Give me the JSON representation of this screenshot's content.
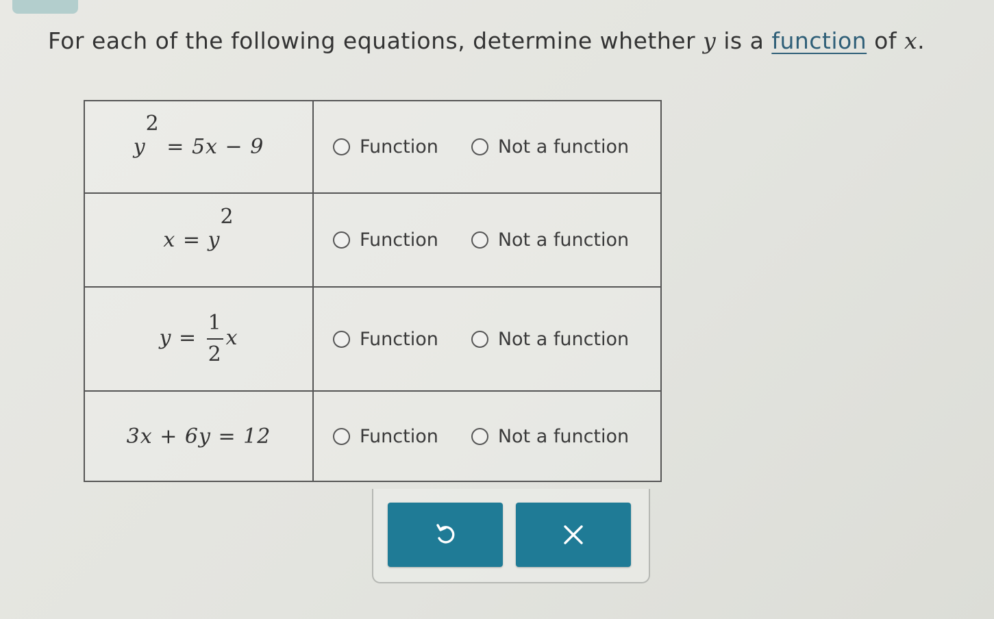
{
  "question": {
    "prefix": "For each of the following equations, determine whether ",
    "var_y": "y",
    "middle": " is a ",
    "link": "function",
    "of_text": " of ",
    "var_x": "x",
    "suffix": "."
  },
  "rows": [
    {
      "equation": {
        "base": "y",
        "exponent": "2",
        "rest": " = 5x − 9"
      },
      "options": [
        "Function",
        "Not a function"
      ]
    },
    {
      "equation": {
        "lhs": "x = ",
        "base": "y",
        "exponent": "2"
      },
      "options": [
        "Function",
        "Not a function"
      ]
    },
    {
      "equation": {
        "lhs": "y = ",
        "numerator": "1",
        "denominator": "2",
        "rhs": "x"
      },
      "options": [
        "Function",
        "Not a function"
      ]
    },
    {
      "equation": {
        "text": "3x + 6y = 12"
      },
      "options": [
        "Function",
        "Not a function"
      ]
    }
  ],
  "actions": {
    "undo_icon": "undo-icon",
    "clear_icon": "close-icon",
    "clear_symbol": "×"
  },
  "colors": {
    "button": "#1f7b96",
    "link": "#2f5f78"
  }
}
